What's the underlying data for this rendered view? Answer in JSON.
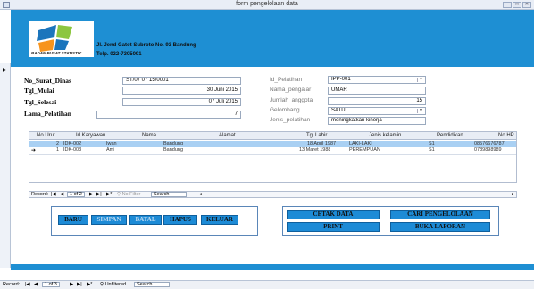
{
  "window": {
    "title": "form pengelolaan data",
    "buttons": [
      "−",
      "□",
      "✕"
    ]
  },
  "header": {
    "logo_caption": "BADAN PUSAT STATISTIK",
    "address": "Jl. Jend Gatot Subroto No. 93 Bandung",
    "phone": "Telp. 022-7305091",
    "color": "#1e8fd3"
  },
  "form": {
    "no_surat_label": "No_Surat_Dinas",
    "no_surat_value": "ST/07 07 15/0001",
    "tgl_mulai_label": "Tgl_Mulai",
    "tgl_mulai_value": "30 Juni 2015",
    "tgl_selesai_label": "Tgl_Selesai",
    "tgl_selesai_value": "07 Juli 2015",
    "lama_label": "Lama_Pelatihan",
    "lama_value": "7",
    "id_pelatihan_label": "Id_Pelatihan",
    "id_pelatihan_value": "IPP-001",
    "nama_pengajar_label": "Nama_pengajar",
    "nama_pengajar_value": "UMAR",
    "jumlah_label": "Jumlah_anggota",
    "jumlah_value": "15",
    "gelombang_label": "Gelombang",
    "gelombang_value": "SATU",
    "jenis_label": "Jenis_pelatihan",
    "jenis_value": "meningkatkan kinerja"
  },
  "grid": {
    "columns": [
      "No Urut",
      "Id Karyawan",
      "Nama",
      "Alamat",
      "Tgl Lahir",
      "Jenis kelamin",
      "Pendidikan",
      "No HP"
    ],
    "rows": [
      [
        "2",
        "IDK-002",
        "Iwan",
        "Bandung",
        "18 April 1987",
        "LAKI-LAKI",
        "S1",
        "08576676787"
      ],
      [
        "1",
        "IDK-003",
        "Ami",
        "Bandung",
        "13 Maret 1988",
        "PEREMPUAN",
        "S1",
        "0789898989"
      ]
    ],
    "nav_record_label": "Record:",
    "nav_position": "1 of 2",
    "nav_filter": "No Filter",
    "nav_search": "Search"
  },
  "buttons": {
    "baru": "BARU",
    "simpan": "SIMPAN",
    "batal": "BATAL",
    "hapus": "HAPUS",
    "keluar": "KELUAR",
    "cetak": "CETAK DATA",
    "print": "PRINT",
    "cari": "CARI PENGELOLAAN",
    "buka": "BUKA LAPORAN",
    "color": "#1d8bd6"
  },
  "status": {
    "record_label": "Record:",
    "position": "1 of 3",
    "filter": "Unfiltered",
    "search": "Search"
  }
}
